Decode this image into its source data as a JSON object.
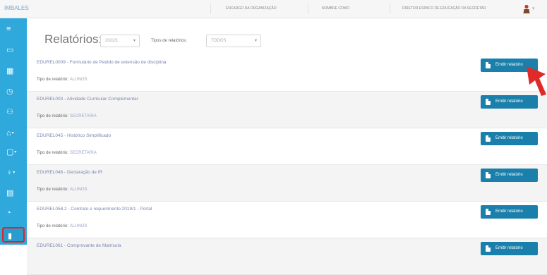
{
  "app": {
    "brand": "IMBALES"
  },
  "topbar": {
    "organization": "ENCARGO DA ORGANIZAÇÃO",
    "user_name": "NOMBRE COMO",
    "role": "DIRETOR ESPACO DE EDUCAÇÃO DA SECRETAR"
  },
  "sidebar": {
    "items": [
      {
        "icon": "menu-icon",
        "glyph": "≡"
      },
      {
        "icon": "monitor-icon",
        "glyph": "▭"
      },
      {
        "icon": "grid-icon",
        "glyph": "▦"
      },
      {
        "icon": "clock-icon",
        "glyph": "◷"
      },
      {
        "icon": "users-icon",
        "glyph": "⚇"
      },
      {
        "icon": "graduation-cap-icon",
        "glyph": "⌂"
      },
      {
        "icon": "clipboard-icon",
        "glyph": "▢"
      },
      {
        "icon": "location-pin-icon",
        "glyph": "♀"
      },
      {
        "icon": "calendar-icon",
        "glyph": "▤"
      },
      {
        "icon": "chart-pie-icon",
        "glyph": "◔"
      },
      {
        "icon": "report-file-icon",
        "glyph": "▮"
      }
    ]
  },
  "page": {
    "title": "Relatórios:",
    "year_value": "2022/1",
    "type_label": "Tipos de relatórios:",
    "type_value": "TODOS"
  },
  "reports": {
    "type_prefix": "Tipo de relatório:",
    "button_label": "Emitir relatório",
    "items": [
      {
        "code": "EDUREL0009 - Formulário de Pedido de extensão de disciplina",
        "type": "ALUNOS"
      },
      {
        "code": "EDUREL003 - Atividade Curricular Complementar",
        "type": "SECRETARIA"
      },
      {
        "code": "EDUREL045 - Histórico Simplificado",
        "type": "SECRETARIA"
      },
      {
        "code": "EDUREL046 - Declaração de IR",
        "type": "ALUNOS"
      },
      {
        "code": "EDUREL058.2 - Contrato e requerimento 2019/1 - Portal",
        "type": "ALUNOS"
      },
      {
        "code": "EDUREL061 - Comprovante de Matrícula",
        "type": ""
      }
    ]
  },
  "colors": {
    "sidebar": "#2fa8dc",
    "button": "#1a7faa",
    "highlight": "#d8262c"
  }
}
